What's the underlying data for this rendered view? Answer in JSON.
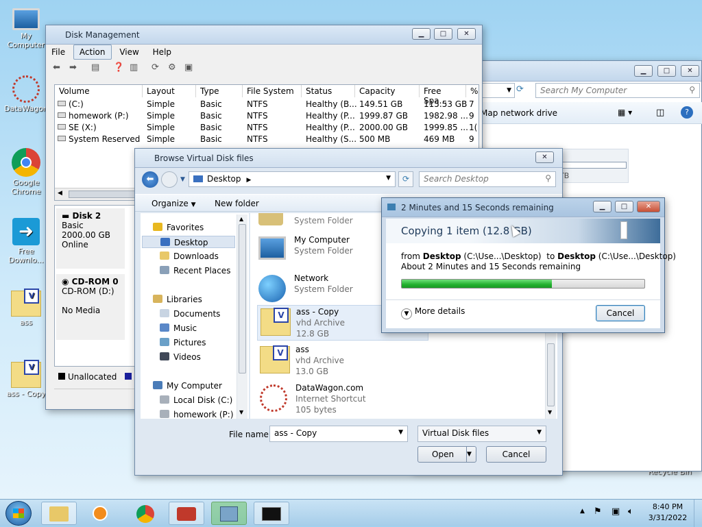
{
  "desktop": {
    "icons": [
      {
        "label": "My Computer"
      },
      {
        "label": "DataWagon"
      },
      {
        "label": "Google Chrome"
      },
      {
        "label": "Free Downlo..."
      },
      {
        "label": "ass"
      },
      {
        "label": "ass - Copy"
      }
    ],
    "recycle_label": "Recycle Bin"
  },
  "disk_mgmt": {
    "title": "Disk Management",
    "menu": [
      "File",
      "Action",
      "View",
      "Help"
    ],
    "columns": [
      "Volume",
      "Layout",
      "Type",
      "File System",
      "Status",
      "Capacity",
      "Free Spa...",
      "%"
    ],
    "rows": [
      [
        "(C:)",
        "Simple",
        "Basic",
        "NTFS",
        "Healthy (B...",
        "149.51 GB",
        "115.53 GB",
        "7"
      ],
      [
        "homework (P:)",
        "Simple",
        "Basic",
        "NTFS",
        "Healthy (P...",
        "1999.87 GB",
        "1982.98 ...",
        "9"
      ],
      [
        "SE (X:)",
        "Simple",
        "Basic",
        "NTFS",
        "Healthy (P...",
        "2000.00 GB",
        "1999.85 ...",
        "1("
      ],
      [
        "System Reserved",
        "Simple",
        "Basic",
        "NTFS",
        "Healthy (S...",
        "500 MB",
        "469 MB",
        "9"
      ]
    ],
    "disk2": {
      "name": "Disk 2",
      "type": "Basic",
      "size": "2000.00 GB",
      "state": "Online"
    },
    "cdrom": {
      "name": "CD-ROM 0",
      "drive": "CD-ROM (D:)",
      "media": "No Media"
    },
    "legend": {
      "unallocated": "Unallocated",
      "primary": "Pr"
    }
  },
  "explorer_bg": {
    "search_placeholder": "Search My Computer",
    "map_label": "Map network drive",
    "tb_label": "TB"
  },
  "browse": {
    "title": "Browse Virtual Disk files",
    "location": "Desktop",
    "search_placeholder": "Search Desktop",
    "organize": "Organize",
    "new_folder": "New folder",
    "nav": {
      "favorites": "Favorites",
      "fav_items": [
        "Desktop",
        "Downloads",
        "Recent Places"
      ],
      "libraries": "Libraries",
      "lib_items": [
        "Documents",
        "Music",
        "Pictures",
        "Videos"
      ],
      "computer": "My Computer",
      "comp_items": [
        "Local Disk (C:)",
        "homework (P:)"
      ]
    },
    "files": [
      {
        "name": "System Folder",
        "sub": "",
        "size": ""
      },
      {
        "name": "My Computer",
        "sub": "System Folder",
        "size": ""
      },
      {
        "name": "Network",
        "sub": "System Folder",
        "size": ""
      },
      {
        "name": "ass - Copy",
        "sub": "vhd Archive",
        "size": "12.8 GB"
      },
      {
        "name": "ass",
        "sub": "vhd Archive",
        "size": "13.0 GB"
      },
      {
        "name": "DataWagon.com",
        "sub": "Internet Shortcut",
        "size": "105 bytes"
      }
    ],
    "filename_label": "File name:",
    "filename_value": "ass - Copy",
    "filter": "Virtual Disk files",
    "open": "Open",
    "cancel": "Cancel"
  },
  "copy": {
    "title": "2 Minutes and 15 Seconds remaining",
    "heading": "Copying 1 item (12.8 GB)",
    "from_word": "from",
    "src": "Desktop",
    "src_path": "(C:\\Use...\\Desktop)",
    "to_word": "to",
    "dst": "Desktop",
    "dst_path": "(C:\\Use...\\Desktop)",
    "remaining": "About 2 Minutes and 15 Seconds remaining",
    "progress": 0.62,
    "more": "More details",
    "cancel": "Cancel"
  },
  "taskbar": {
    "time": "8:40 PM",
    "date": "3/31/2022"
  },
  "colors": {
    "accent": "#3c7fb1",
    "progress": "#2fbf3a"
  }
}
